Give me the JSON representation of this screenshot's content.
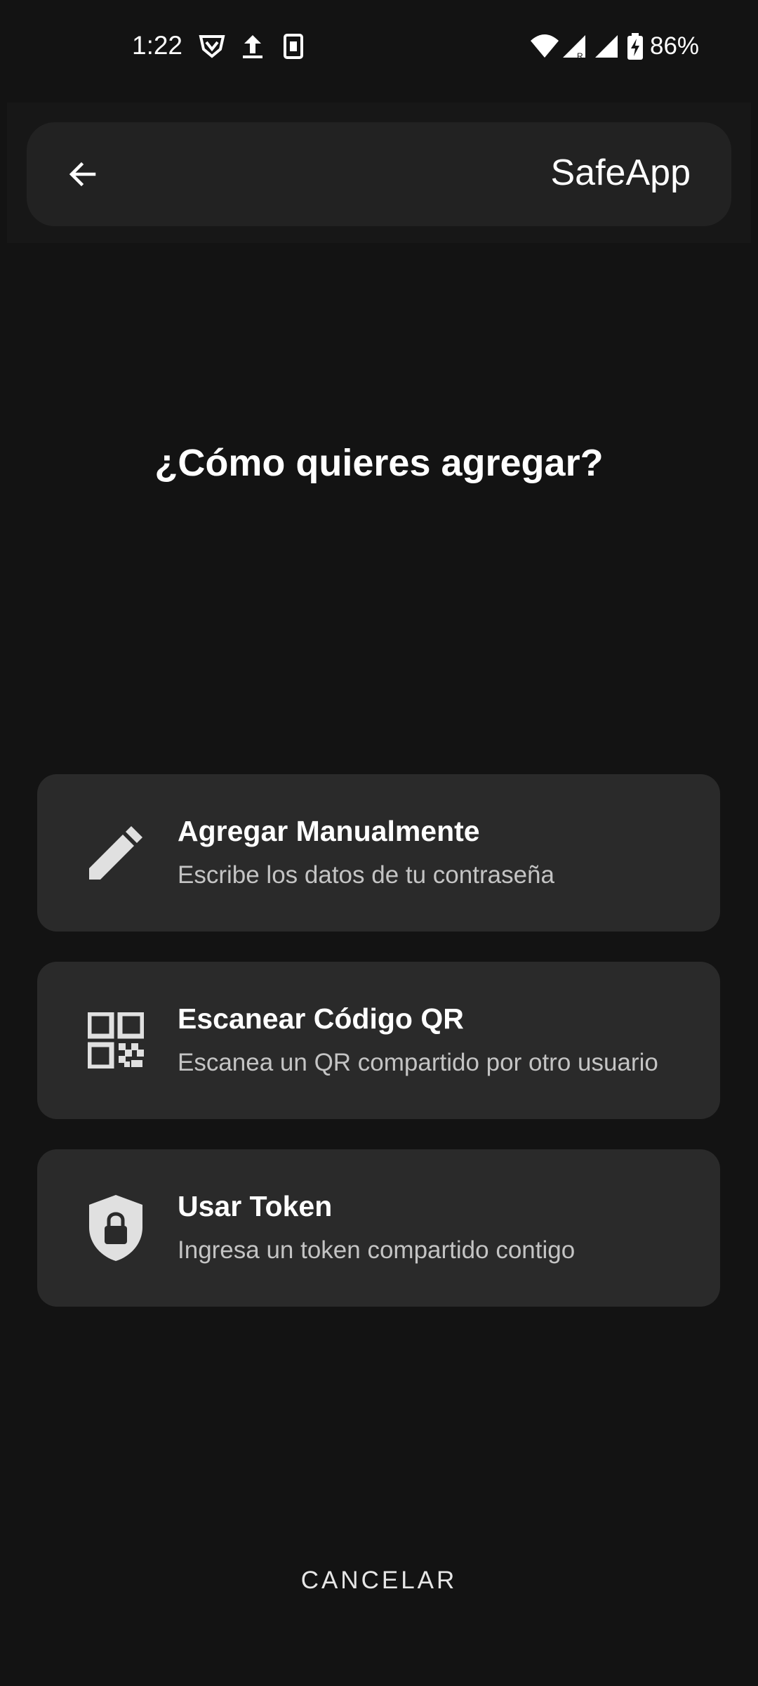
{
  "status_bar": {
    "time": "1:22",
    "battery_percent": "86%",
    "icons": [
      "vpn-shield-icon",
      "upload-icon",
      "sim-card-icon",
      "wifi-icon",
      "signal-roaming-icon",
      "signal-icon",
      "battery-charging-icon"
    ]
  },
  "appbar": {
    "back_icon": "arrow-back-icon",
    "title": "SafeApp"
  },
  "heading": "¿Cómo quieres agregar?",
  "options": [
    {
      "icon": "pencil-icon",
      "title": "Agregar Manualmente",
      "subtitle": "Escribe los datos de tu contraseña"
    },
    {
      "icon": "qr-code-icon",
      "title": "Escanear Código QR",
      "subtitle": "Escanea un QR compartido por otro usuario"
    },
    {
      "icon": "shield-lock-icon",
      "title": "Usar Token",
      "subtitle": "Ingresa un token compartido contigo"
    }
  ],
  "cancel_label": "CANCELAR",
  "colors": {
    "background": "#131313",
    "card": "#2a2a2a",
    "appbar": "#222222",
    "subtitle_text": "#c4c4c4",
    "icon": "#e0e0e0"
  }
}
